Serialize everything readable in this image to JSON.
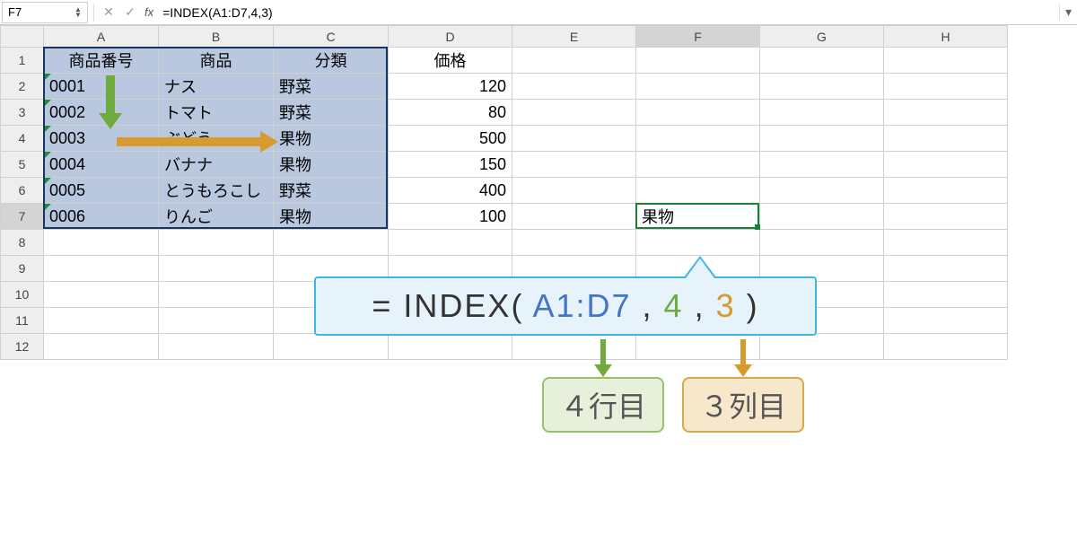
{
  "formula_bar": {
    "cell_ref": "F7",
    "fx_label": "fx",
    "formula": "=INDEX(A1:D7,4,3)"
  },
  "columns": [
    "A",
    "B",
    "C",
    "D",
    "E",
    "F",
    "G",
    "H"
  ],
  "rows": [
    "1",
    "2",
    "3",
    "4",
    "5",
    "6",
    "7",
    "8",
    "9",
    "10",
    "11",
    "12"
  ],
  "headers": {
    "a": "商品番号",
    "b": "商品",
    "c": "分類",
    "d": "価格"
  },
  "data": [
    {
      "code": "0001",
      "name": "ナス",
      "cat": "野菜",
      "price": "120"
    },
    {
      "code": "0002",
      "name": "トマト",
      "cat": "野菜",
      "price": "80"
    },
    {
      "code": "0003",
      "name": "ぶどう",
      "cat": "果物",
      "price": "500"
    },
    {
      "code": "0004",
      "name": "バナナ",
      "cat": "果物",
      "price": "150"
    },
    {
      "code": "0005",
      "name": "とうもろこし",
      "cat": "野菜",
      "price": "400"
    },
    {
      "code": "0006",
      "name": "りんご",
      "cat": "果物",
      "price": "100"
    }
  ],
  "result_cell": "果物",
  "callout": {
    "eq": "= INDEX( ",
    "range": "A1:D7",
    "c1": " , ",
    "row": "4",
    "c2": " , ",
    "col": "3",
    "close": " )"
  },
  "labels": {
    "row": "４行目",
    "col": "３列目"
  },
  "chart_data": {
    "type": "table",
    "title": "",
    "columns": [
      "商品番号",
      "商品",
      "分類",
      "価格"
    ],
    "rows": [
      [
        "0001",
        "ナス",
        "野菜",
        120
      ],
      [
        "0002",
        "トマト",
        "野菜",
        80
      ],
      [
        "0003",
        "ぶどう",
        "果物",
        500
      ],
      [
        "0004",
        "バナナ",
        "果物",
        150
      ],
      [
        "0005",
        "とうもろこし",
        "野菜",
        400
      ],
      [
        "0006",
        "りんご",
        "果物",
        100
      ]
    ],
    "formula": "=INDEX(A1:D7,4,3)",
    "result": "果物"
  }
}
